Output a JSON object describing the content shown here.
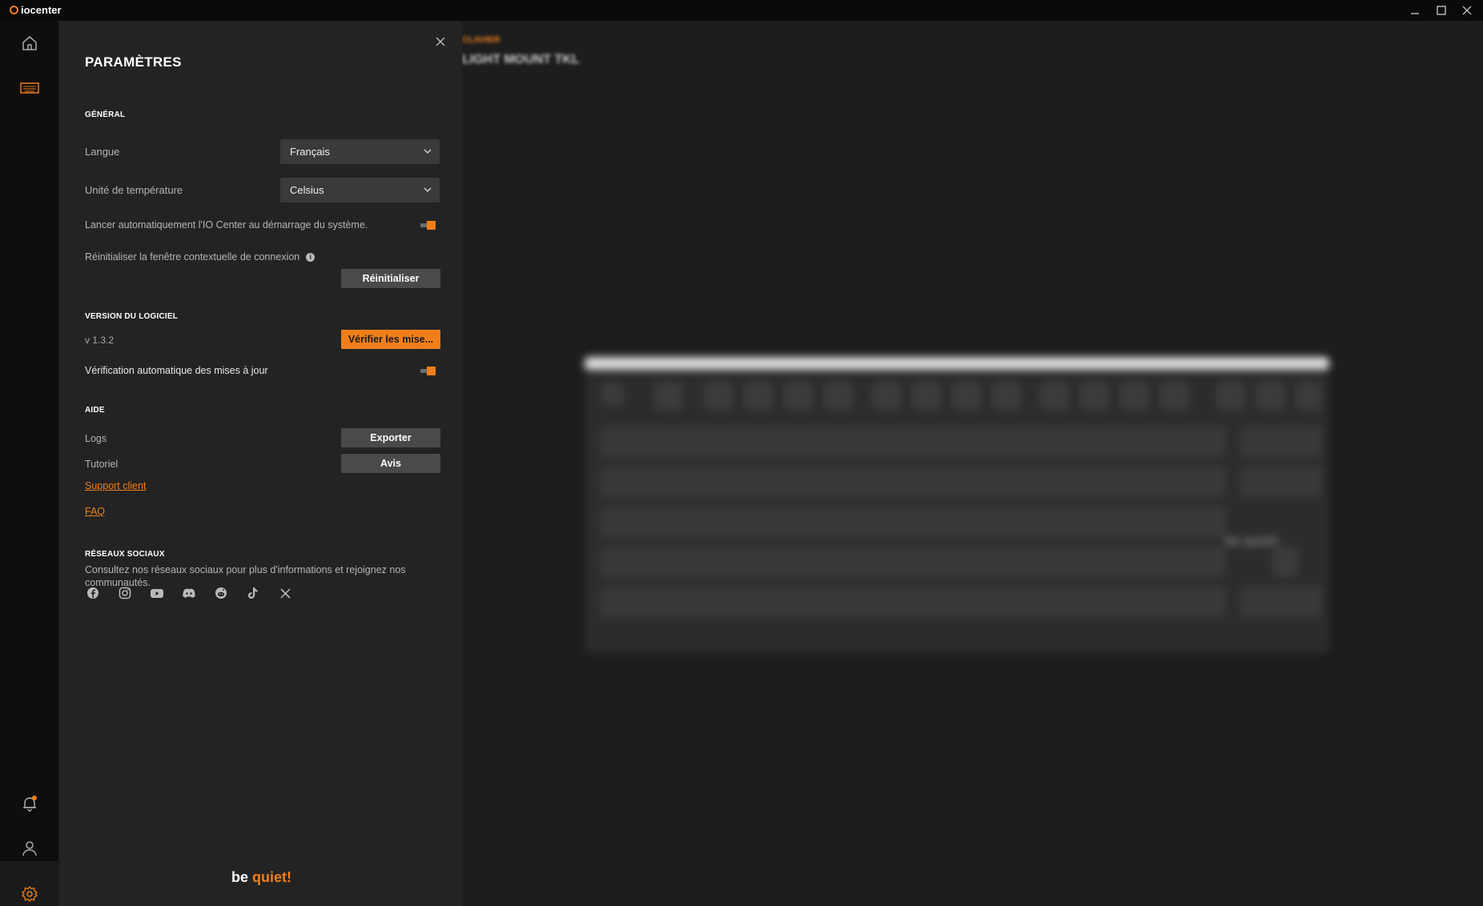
{
  "app": {
    "name": "iocenter"
  },
  "window": {
    "minimize_icon": "minimize-icon",
    "maximize_icon": "maximize-icon",
    "close_icon": "close-icon"
  },
  "nav": {
    "top": [
      "home-icon",
      "keyboard-icon"
    ],
    "bottom": [
      "bell-icon",
      "user-icon",
      "gear-icon"
    ]
  },
  "background": {
    "breadcrumb": "CLAVIER",
    "device_name": "LIGHT MOUNT TKL",
    "keyboard_brand": "be quiet!"
  },
  "settings": {
    "title": "PARAMÈTRES",
    "general": {
      "heading": "GÉNÉRAL",
      "language_label": "Langue",
      "language_value": "Français",
      "temperature_label": "Unité de température",
      "temperature_value": "Celsius",
      "autostart_label": "Lancer automatiquement l'IO Center au démarrage du système.",
      "autostart_on": true,
      "reset_popup_label": "Réinitialiser la fenêtre contextuelle de connexion",
      "reset_button": "Réinitialiser"
    },
    "version": {
      "heading": "VERSION DU LOGICIEL",
      "value": "v 1.3.2",
      "check_button": "Vérifier les mise...",
      "auto_check_label": "Vérification automatique des mises à jour",
      "auto_check_on": true
    },
    "help": {
      "heading": "AIDE",
      "logs_label": "Logs",
      "export_button": "Exporter",
      "tutorial_label": "Tutoriel",
      "tutorial_button": "Avis",
      "support_link": "Support client",
      "faq_link": "FAQ"
    },
    "social": {
      "heading": "RÉSEAUX SOCIAUX",
      "description": "Consultez nos réseaux sociaux pour plus d'informations et rejoignez nos communautés.",
      "icons": [
        "facebook-icon",
        "instagram-icon",
        "youtube-icon",
        "discord-icon",
        "reddit-icon",
        "tiktok-icon",
        "x-icon"
      ]
    },
    "brand": {
      "be": "be",
      "quiet": "quiet!"
    }
  },
  "colors": {
    "accent": "#f07f1a",
    "panel": "#232323",
    "sidebar": "#0e0e0e",
    "main": "#1d1d1d"
  }
}
